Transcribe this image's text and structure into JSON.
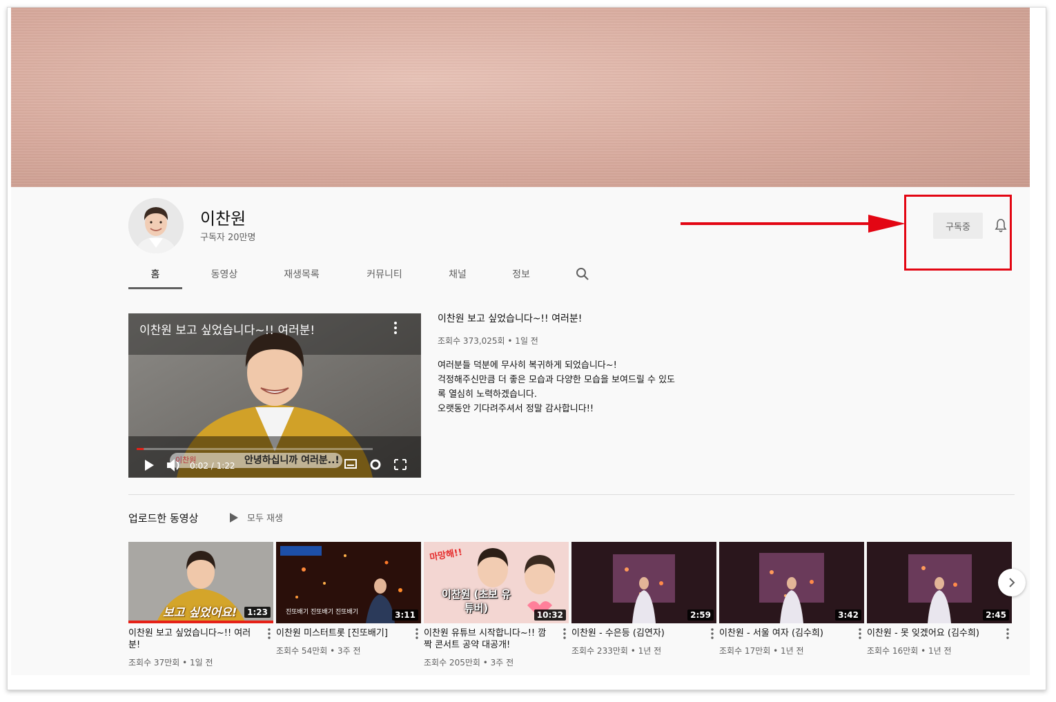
{
  "channel": {
    "name": "이찬원",
    "subscribers": "구독자 20만명"
  },
  "subscribe": {
    "label": "구독중"
  },
  "tabs": [
    {
      "label": "홈",
      "active": true
    },
    {
      "label": "동영상"
    },
    {
      "label": "재생목록"
    },
    {
      "label": "커뮤니티"
    },
    {
      "label": "채널"
    },
    {
      "label": "정보"
    }
  ],
  "featured": {
    "player_title": "이찬원 보고 싶었습니다~!! 여러분!",
    "caption": "안녕하십니까 여러분..!",
    "caption_tag": "이찬원",
    "time": "0:02 / 1:22",
    "progress": 0.03,
    "title": "이찬원 보고 싶었습니다~!! 여러분!",
    "meta": "조회수 373,025회 • 1일 전",
    "description": [
      "여러분들 덕분에 무사히 복귀하게 되었습니다~!",
      "걱정해주신만큼 더 좋은 모습과 다양한 모습을 보여드릴 수 있도",
      "록 열심히 노력하겠습니다.",
      "오랫동안 기다려주셔서 정말 감사합니다!!"
    ]
  },
  "uploads": {
    "title": "업로드한 동영상",
    "play_all": "모두 재생",
    "videos": [
      {
        "duration": "1:23",
        "title": "이찬원 보고 싶었습니다~!! 여러분!",
        "meta": "조회수 37만회 • 1일 전",
        "overlay": "보고 싶었어요!"
      },
      {
        "duration": "3:11",
        "title": "이찬원 미스터트롯 [진또배기]",
        "meta": "조회수 54만회 • 3주 전",
        "overlay": "진또배기 진또배기 진또배기"
      },
      {
        "duration": "10:32",
        "title": "이찬원 유튜브 시작합니다~!! 깜짝 콘서트 공약 대공개!",
        "meta": "조회수 205만회 • 3주 전",
        "overlay": "이찬원 (초보 유튜버)",
        "overlay_top": "마망해!!"
      },
      {
        "duration": "2:59",
        "title": "이찬원 - 수은등 (김연자)",
        "meta": "조회수 233만회 • 1년 전"
      },
      {
        "duration": "3:42",
        "title": "이찬원 - 서울 여자 (김수희)",
        "meta": "조회수 17만회 • 1년 전"
      },
      {
        "duration": "2:45",
        "title": "이찬원 - 못 잊겠어요 (김수희)",
        "meta": "조회수 16만회 • 1년 전"
      }
    ]
  },
  "colors": {
    "accent_red": "#e30613",
    "progress_red": "#e62117"
  }
}
